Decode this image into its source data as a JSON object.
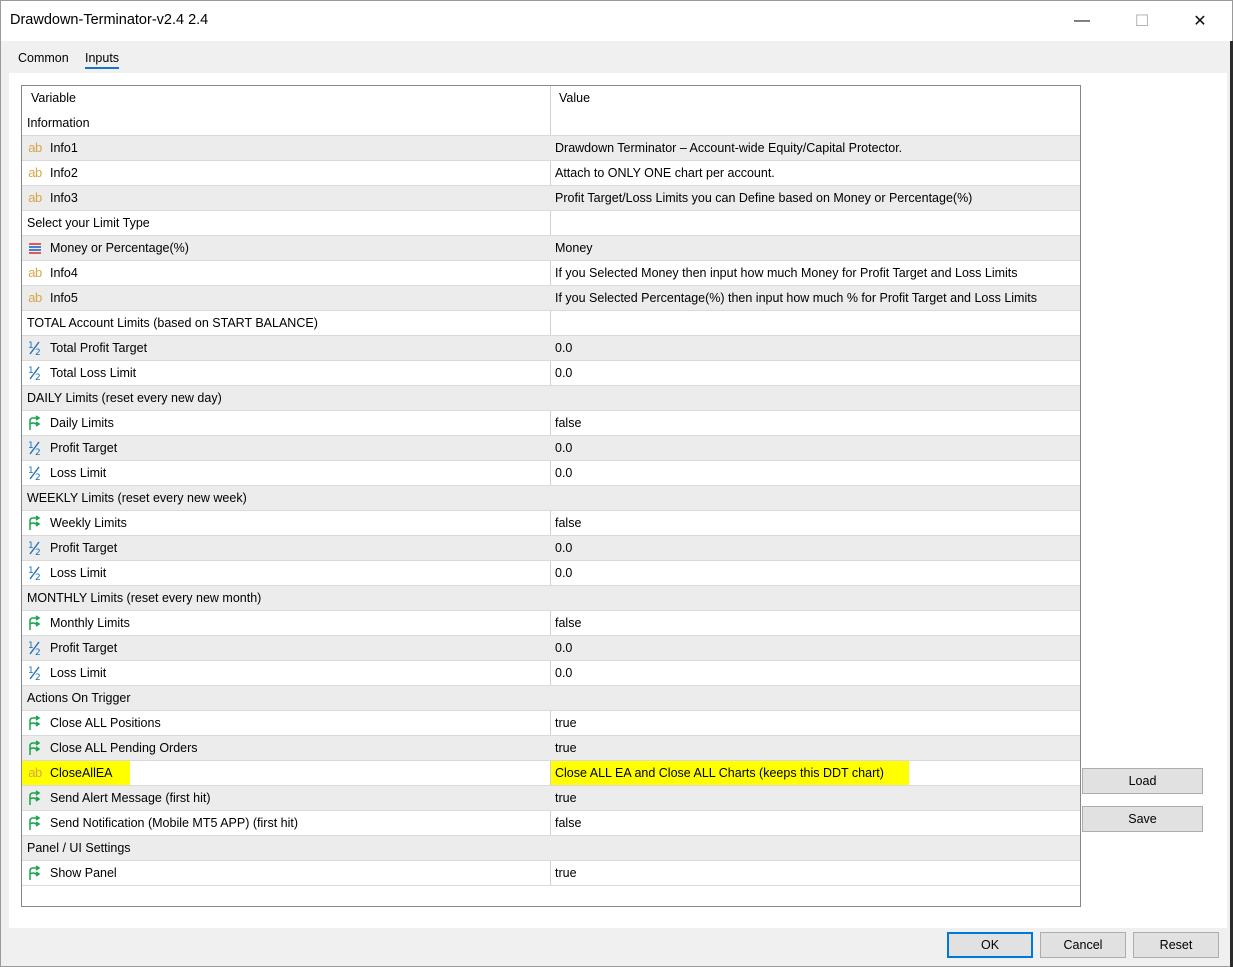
{
  "window": {
    "title": "Drawdown-Terminator-v2.4 2.4",
    "minimize_glyph": "—",
    "maximize_glyph": "☐",
    "close_glyph": "✕"
  },
  "tabs": [
    {
      "label": "Common",
      "selected": false
    },
    {
      "label": "Inputs",
      "selected": true
    }
  ],
  "grid": {
    "header": {
      "variable": "Variable",
      "value": "Value"
    },
    "rows": [
      {
        "type": "group",
        "label": "Information",
        "value": ""
      },
      {
        "type": "item",
        "icon": "string-ab-icon",
        "label": "Info1",
        "value": "Drawdown Terminator – Account-wide Equity/Capital Protector."
      },
      {
        "type": "item",
        "icon": "string-ab-icon",
        "label": "Info2",
        "value": "Attach to ONLY ONE chart per account."
      },
      {
        "type": "item",
        "icon": "string-ab-icon",
        "label": "Info3",
        "value": "Profit Target/Loss Limits you can Define based on Money or Percentage(%)"
      },
      {
        "type": "group",
        "label": "Select your Limit Type",
        "value": ""
      },
      {
        "type": "item",
        "icon": "enum-list-icon",
        "label": "Money or Percentage(%)",
        "value": "Money"
      },
      {
        "type": "item",
        "icon": "string-ab-icon",
        "label": "Info4",
        "value": "If you Selected Money then input how much Money for Profit Target and Loss Limits"
      },
      {
        "type": "item",
        "icon": "string-ab-icon",
        "label": "Info5",
        "value": "If you Selected Percentage(%) then input how much % for Profit Target and Loss Limits"
      },
      {
        "type": "group",
        "label": "TOTAL Account Limits (based on START BALANCE)",
        "value": ""
      },
      {
        "type": "item",
        "icon": "double-half-icon",
        "label": "Total Profit Target",
        "value": "0.0"
      },
      {
        "type": "item",
        "icon": "double-half-icon",
        "label": "Total Loss Limit",
        "value": "0.0"
      },
      {
        "type": "group",
        "label": "DAILY Limits (reset every new day)",
        "value": ""
      },
      {
        "type": "item",
        "icon": "bool-arrow-icon",
        "label": "Daily Limits",
        "value": "false"
      },
      {
        "type": "item",
        "icon": "double-half-icon",
        "label": "Profit Target",
        "value": "0.0"
      },
      {
        "type": "item",
        "icon": "double-half-icon",
        "label": "Loss Limit",
        "value": "0.0"
      },
      {
        "type": "group",
        "label": "WEEKLY Limits (reset every new week)",
        "value": ""
      },
      {
        "type": "item",
        "icon": "bool-arrow-icon",
        "label": "Weekly Limits",
        "value": "false"
      },
      {
        "type": "item",
        "icon": "double-half-icon",
        "label": "Profit Target",
        "value": "0.0"
      },
      {
        "type": "item",
        "icon": "double-half-icon",
        "label": "Loss Limit",
        "value": "0.0"
      },
      {
        "type": "group",
        "label": "MONTHLY Limits (reset every new month)",
        "value": ""
      },
      {
        "type": "item",
        "icon": "bool-arrow-icon",
        "label": "Monthly Limits",
        "value": "false"
      },
      {
        "type": "item",
        "icon": "double-half-icon",
        "label": "Profit Target",
        "value": "0.0"
      },
      {
        "type": "item",
        "icon": "double-half-icon",
        "label": "Loss Limit",
        "value": "0.0"
      },
      {
        "type": "group",
        "label": "Actions On Trigger",
        "value": ""
      },
      {
        "type": "item",
        "icon": "bool-arrow-icon",
        "label": "Close ALL Positions",
        "value": "true"
      },
      {
        "type": "item",
        "icon": "bool-arrow-icon",
        "label": "Close ALL Pending Orders",
        "value": "true"
      },
      {
        "type": "item",
        "icon": "string-ab-icon",
        "label": "CloseAllEA",
        "value": "Close ALL EA and Close ALL Charts  (keeps this DDT chart)",
        "highlight": true
      },
      {
        "type": "item",
        "icon": "bool-arrow-icon",
        "label": "Send Alert Message (first hit)",
        "value": "true"
      },
      {
        "type": "item",
        "icon": "bool-arrow-icon",
        "label": "Send Notification (Mobile MT5 APP) (first hit)",
        "value": "false"
      },
      {
        "type": "group",
        "label": "Panel / UI Settings",
        "value": ""
      },
      {
        "type": "item",
        "icon": "bool-arrow-icon",
        "label": "Show Panel",
        "value": "true"
      }
    ]
  },
  "buttons": {
    "load": "Load",
    "save": "Save",
    "ok": "OK",
    "cancel": "Cancel",
    "reset": "Reset"
  },
  "colors": {
    "highlight": "#ffff00",
    "shaded_row": "#ececec",
    "ab_icon": "#d4a74a",
    "bool_icon": "#1aa34a",
    "double_icon": "#1f6fb5",
    "accent": "#0078d7"
  }
}
